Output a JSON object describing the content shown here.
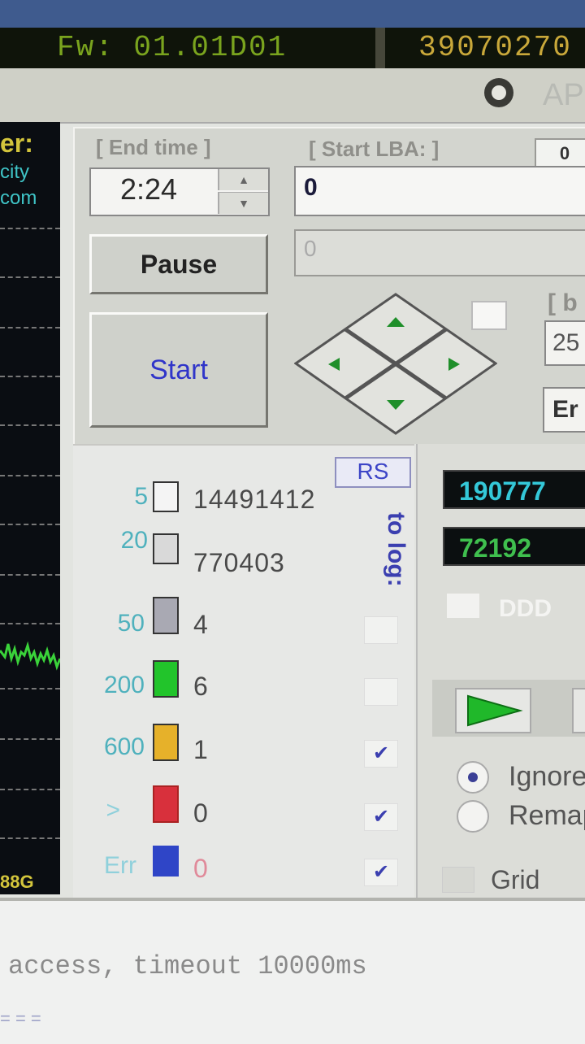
{
  "header": {
    "firmware": "Fw: 01.01D01",
    "serial": "39070270",
    "api_label": "AP"
  },
  "map_panel": {
    "title_fragment": "er:",
    "line1": "city",
    "line2": "com",
    "capacity": "88G"
  },
  "controls": {
    "end_time_label": "[ End time ]",
    "end_time_value": "2:24",
    "start_lba_label": "[ Start LBA: ]",
    "start_lba_small": "0",
    "start_lba_value": "0",
    "end_lba_value": "0",
    "pause_label": "Pause",
    "start_label": "Start",
    "block_size_label": "[ b",
    "block_size_value": "25",
    "mode_value": "Er"
  },
  "stats": {
    "rs_label": "RS",
    "to_log_label": "to log:",
    "rows": [
      {
        "threshold": "5",
        "color": "#f4f4f4",
        "count": "14491412",
        "log": false
      },
      {
        "threshold": "20",
        "color": "#d9d9d9",
        "count": "770403",
        "log": false
      },
      {
        "threshold": "50",
        "color": "#a9a9b3",
        "count": "4",
        "log": false
      },
      {
        "threshold": "200",
        "color": "#22c42b",
        "count": "6",
        "log": false
      },
      {
        "threshold": "600",
        "color": "#e6b12a",
        "count": "1",
        "log": true
      },
      {
        "threshold": ">",
        "color": "#d8303c",
        "count": "0",
        "log": true
      },
      {
        "threshold": "Err",
        "color": "#2f45c7",
        "count": "0",
        "log": true
      }
    ],
    "check_mark": "✔"
  },
  "right_panel": {
    "counter1": "190777",
    "counter2": "72192",
    "ddd_label": "DDD",
    "ignore_label": "Ignore",
    "remap_label": "Remap",
    "grid_label": "Grid"
  },
  "log": {
    "line": "access, timeout 10000ms",
    "dots": "= = ="
  }
}
